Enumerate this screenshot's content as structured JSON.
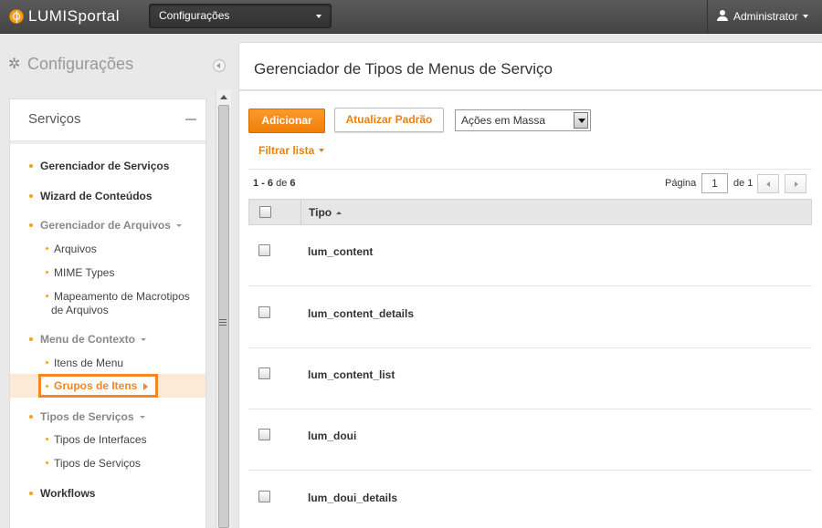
{
  "topbar": {
    "logo_prefix": "LUMIS",
    "logo_suffix": "portal",
    "app_select": "Configurações",
    "user": "Administrator"
  },
  "sidebar": {
    "title": "Configurações",
    "panel_title": "Serviços",
    "items": [
      {
        "label": "Gerenciador de Serviços"
      },
      {
        "label": "Wizard de Conteúdos"
      },
      {
        "label": "Gerenciador de Arquivos"
      },
      {
        "label": "Arquivos"
      },
      {
        "label": "MIME Types"
      },
      {
        "label": "Mapeamento de Macrotipos"
      },
      {
        "label": "de Arquivos"
      },
      {
        "label": "Menu de Contexto"
      },
      {
        "label": "Itens de Menu"
      },
      {
        "label": "Grupos de Itens"
      },
      {
        "label": "Tipos de Serviços"
      },
      {
        "label": "Tipos de Interfaces"
      },
      {
        "label": "Tipos de Serviços"
      },
      {
        "label": "Workflows"
      }
    ]
  },
  "main": {
    "title": "Gerenciador de Tipos de Menus de Serviço",
    "add_label": "Adicionar",
    "reset_label": "Atualizar Padrão",
    "mass_actions": "Ações em Massa",
    "filter_label": "Filtrar lista",
    "count_range": "1 - 6",
    "count_of": "de",
    "count_total": "6",
    "page_label": "Página",
    "page_value": "1",
    "page_of": "de 1",
    "column_type": "Tipo",
    "rows": [
      {
        "tipo": "lum_content"
      },
      {
        "tipo": "lum_content_details"
      },
      {
        "tipo": "lum_content_list"
      },
      {
        "tipo": "lum_doui"
      },
      {
        "tipo": "lum_doui_details"
      }
    ]
  },
  "colors": {
    "accent": "#f68620",
    "topbar": "#4a4a4a",
    "active_bg": "#fde9d5"
  }
}
